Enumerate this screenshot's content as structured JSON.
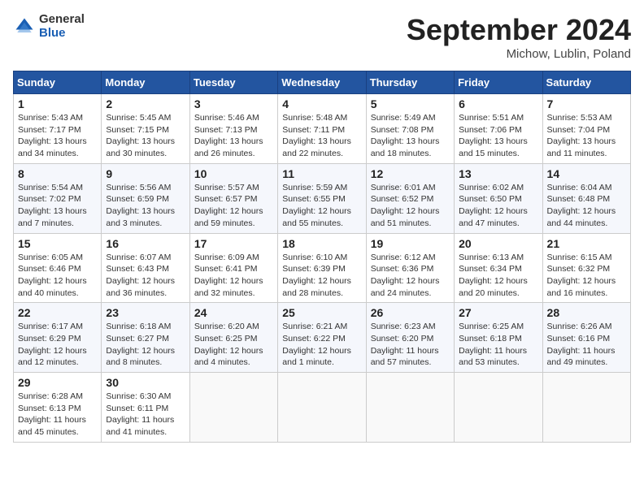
{
  "header": {
    "logo_general": "General",
    "logo_blue": "Blue",
    "month": "September 2024",
    "location": "Michow, Lublin, Poland"
  },
  "days_of_week": [
    "Sunday",
    "Monday",
    "Tuesday",
    "Wednesday",
    "Thursday",
    "Friday",
    "Saturday"
  ],
  "weeks": [
    [
      {
        "day": "1",
        "info": "Sunrise: 5:43 AM\nSunset: 7:17 PM\nDaylight: 13 hours\nand 34 minutes."
      },
      {
        "day": "2",
        "info": "Sunrise: 5:45 AM\nSunset: 7:15 PM\nDaylight: 13 hours\nand 30 minutes."
      },
      {
        "day": "3",
        "info": "Sunrise: 5:46 AM\nSunset: 7:13 PM\nDaylight: 13 hours\nand 26 minutes."
      },
      {
        "day": "4",
        "info": "Sunrise: 5:48 AM\nSunset: 7:11 PM\nDaylight: 13 hours\nand 22 minutes."
      },
      {
        "day": "5",
        "info": "Sunrise: 5:49 AM\nSunset: 7:08 PM\nDaylight: 13 hours\nand 18 minutes."
      },
      {
        "day": "6",
        "info": "Sunrise: 5:51 AM\nSunset: 7:06 PM\nDaylight: 13 hours\nand 15 minutes."
      },
      {
        "day": "7",
        "info": "Sunrise: 5:53 AM\nSunset: 7:04 PM\nDaylight: 13 hours\nand 11 minutes."
      }
    ],
    [
      {
        "day": "8",
        "info": "Sunrise: 5:54 AM\nSunset: 7:02 PM\nDaylight: 13 hours\nand 7 minutes."
      },
      {
        "day": "9",
        "info": "Sunrise: 5:56 AM\nSunset: 6:59 PM\nDaylight: 13 hours\nand 3 minutes."
      },
      {
        "day": "10",
        "info": "Sunrise: 5:57 AM\nSunset: 6:57 PM\nDaylight: 12 hours\nand 59 minutes."
      },
      {
        "day": "11",
        "info": "Sunrise: 5:59 AM\nSunset: 6:55 PM\nDaylight: 12 hours\nand 55 minutes."
      },
      {
        "day": "12",
        "info": "Sunrise: 6:01 AM\nSunset: 6:52 PM\nDaylight: 12 hours\nand 51 minutes."
      },
      {
        "day": "13",
        "info": "Sunrise: 6:02 AM\nSunset: 6:50 PM\nDaylight: 12 hours\nand 47 minutes."
      },
      {
        "day": "14",
        "info": "Sunrise: 6:04 AM\nSunset: 6:48 PM\nDaylight: 12 hours\nand 44 minutes."
      }
    ],
    [
      {
        "day": "15",
        "info": "Sunrise: 6:05 AM\nSunset: 6:46 PM\nDaylight: 12 hours\nand 40 minutes."
      },
      {
        "day": "16",
        "info": "Sunrise: 6:07 AM\nSunset: 6:43 PM\nDaylight: 12 hours\nand 36 minutes."
      },
      {
        "day": "17",
        "info": "Sunrise: 6:09 AM\nSunset: 6:41 PM\nDaylight: 12 hours\nand 32 minutes."
      },
      {
        "day": "18",
        "info": "Sunrise: 6:10 AM\nSunset: 6:39 PM\nDaylight: 12 hours\nand 28 minutes."
      },
      {
        "day": "19",
        "info": "Sunrise: 6:12 AM\nSunset: 6:36 PM\nDaylight: 12 hours\nand 24 minutes."
      },
      {
        "day": "20",
        "info": "Sunrise: 6:13 AM\nSunset: 6:34 PM\nDaylight: 12 hours\nand 20 minutes."
      },
      {
        "day": "21",
        "info": "Sunrise: 6:15 AM\nSunset: 6:32 PM\nDaylight: 12 hours\nand 16 minutes."
      }
    ],
    [
      {
        "day": "22",
        "info": "Sunrise: 6:17 AM\nSunset: 6:29 PM\nDaylight: 12 hours\nand 12 minutes."
      },
      {
        "day": "23",
        "info": "Sunrise: 6:18 AM\nSunset: 6:27 PM\nDaylight: 12 hours\nand 8 minutes."
      },
      {
        "day": "24",
        "info": "Sunrise: 6:20 AM\nSunset: 6:25 PM\nDaylight: 12 hours\nand 4 minutes."
      },
      {
        "day": "25",
        "info": "Sunrise: 6:21 AM\nSunset: 6:22 PM\nDaylight: 12 hours\nand 1 minute."
      },
      {
        "day": "26",
        "info": "Sunrise: 6:23 AM\nSunset: 6:20 PM\nDaylight: 11 hours\nand 57 minutes."
      },
      {
        "day": "27",
        "info": "Sunrise: 6:25 AM\nSunset: 6:18 PM\nDaylight: 11 hours\nand 53 minutes."
      },
      {
        "day": "28",
        "info": "Sunrise: 6:26 AM\nSunset: 6:16 PM\nDaylight: 11 hours\nand 49 minutes."
      }
    ],
    [
      {
        "day": "29",
        "info": "Sunrise: 6:28 AM\nSunset: 6:13 PM\nDaylight: 11 hours\nand 45 minutes."
      },
      {
        "day": "30",
        "info": "Sunrise: 6:30 AM\nSunset: 6:11 PM\nDaylight: 11 hours\nand 41 minutes."
      },
      {
        "day": "",
        "info": ""
      },
      {
        "day": "",
        "info": ""
      },
      {
        "day": "",
        "info": ""
      },
      {
        "day": "",
        "info": ""
      },
      {
        "day": "",
        "info": ""
      }
    ]
  ]
}
